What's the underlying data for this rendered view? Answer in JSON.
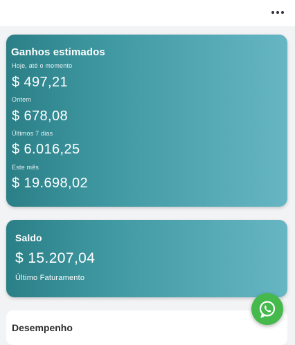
{
  "topbar": {
    "menu_icon": "more-horizontal-icon"
  },
  "earnings": {
    "title": "Ganhos estimados",
    "items": [
      {
        "label": "Hoje, até o momento",
        "amount": "$ 497,21"
      },
      {
        "label": "Ontem",
        "amount": "$ 678,08"
      },
      {
        "label": "Últimos 7 dias",
        "amount": "$ 6.016,25"
      },
      {
        "label": "Este mês",
        "amount": "$ 19.698,02"
      }
    ]
  },
  "balance": {
    "title": "Saldo",
    "amount": "$ 15.207,04",
    "subtitle": "Último Faturamento"
  },
  "performance": {
    "title": "Desempenho"
  },
  "fab": {
    "icon": "whatsapp-icon"
  },
  "colors": {
    "card_gradient_start": "#2b7f87",
    "card_gradient_end": "#66b6c3",
    "whatsapp_green": "#45b94c"
  }
}
